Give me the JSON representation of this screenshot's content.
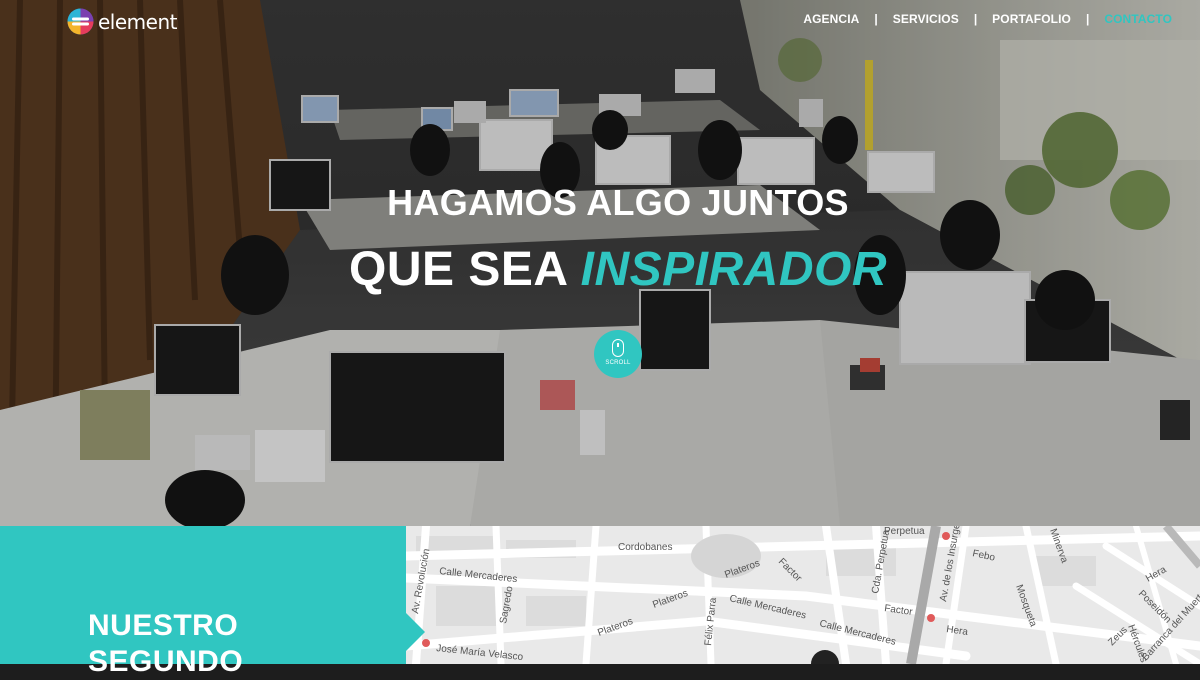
{
  "brand": {
    "name": "element",
    "accent": "#30c6c1",
    "logo_icon": "element-logo-icon"
  },
  "nav": {
    "items": [
      {
        "label": "AGENCIA",
        "active": false
      },
      {
        "label": "SERVICIOS",
        "active": false
      },
      {
        "label": "PORTAFOLIO",
        "active": false
      },
      {
        "label": "CONTACTO",
        "active": true
      }
    ],
    "separator": "|"
  },
  "hero": {
    "line1": "HAGAMOS ALGO JUNTOS",
    "line2_prefix": "QUE SEA",
    "line2_accent": "INSPIRADOR",
    "scroll_label": "SCROLL",
    "background": "office-photo"
  },
  "section": {
    "title": "NUESTRO SEGUNDO"
  },
  "map": {
    "streets": [
      "Calle Mercaderes",
      "Calle Mercaderes",
      "Calle Mercaderes",
      "Cordobanes",
      "Av. Revolución",
      "Sagredo",
      "Plateros",
      "Plateros",
      "Plateros",
      "Félix Parra",
      "José María Velasco",
      "Factor",
      "Factor",
      "Cda. Perpetua",
      "Perpetua",
      "Av. de los Insurgentes",
      "Febo",
      "Mosqueta",
      "Minerva",
      "Hera",
      "Hera",
      "Poseidón",
      "Zeus",
      "Hércules",
      "Barranca del Muerto"
    ]
  }
}
